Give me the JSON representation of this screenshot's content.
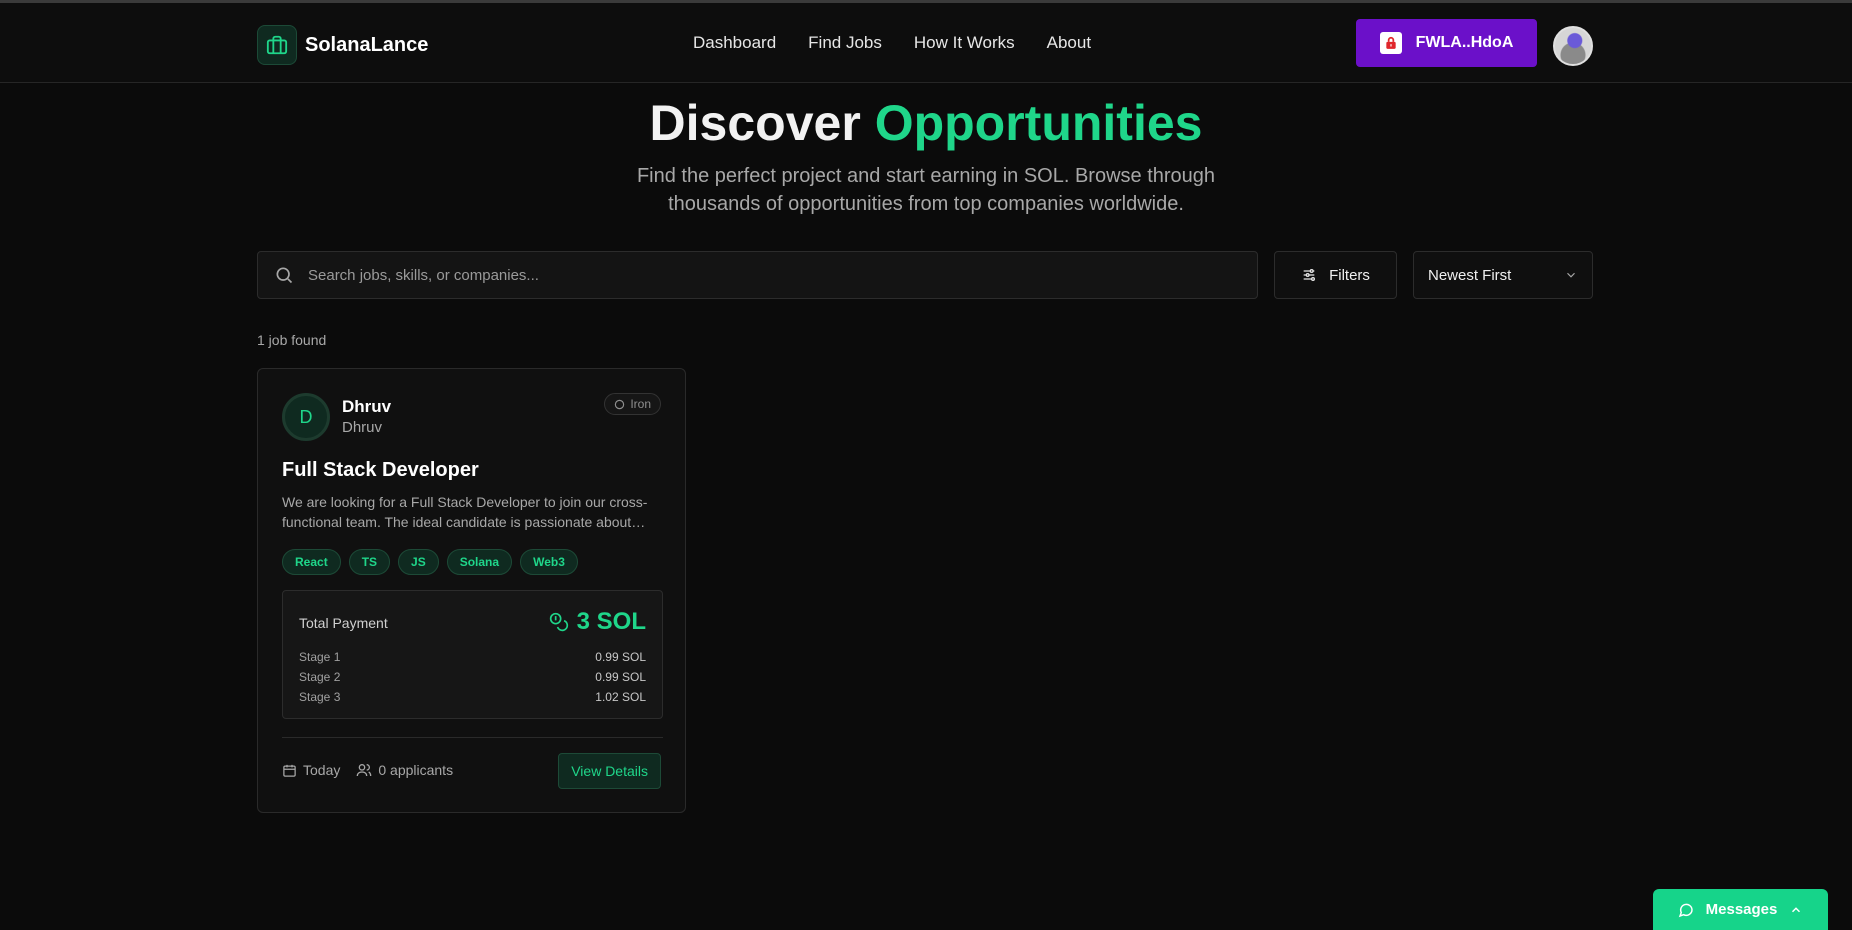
{
  "app": {
    "name": "SolanaLance"
  },
  "nav": {
    "links": [
      "Dashboard",
      "Find Jobs",
      "How It Works",
      "About"
    ]
  },
  "wallet": {
    "label": "FWLA..HdoA"
  },
  "hero": {
    "title_main": "Discover",
    "title_accent": "Opportunities",
    "subtitle": "Find the perfect project and start earning in SOL. Browse through thousands of opportunities from top companies worldwide."
  },
  "search": {
    "placeholder": "Search jobs, skills, or companies...",
    "value": ""
  },
  "filters": {
    "label": "Filters"
  },
  "sort": {
    "selected": "Newest First"
  },
  "results": {
    "count_text": "1 job found"
  },
  "jobs": [
    {
      "avatar_initial": "D",
      "poster_name": "Dhruv",
      "company": "Dhruv",
      "tier": "Iron",
      "title": "Full Stack Developer",
      "description": "We are looking for a Full Stack Developer to join our cross-functional team. The ideal candidate is passionate about building scalable products.",
      "tags": [
        "React",
        "TS",
        "JS",
        "Solana",
        "Web3"
      ],
      "payment": {
        "label": "Total Payment",
        "total": "3 SOL",
        "stages": [
          {
            "name": "Stage 1",
            "amount": "0.99 SOL"
          },
          {
            "name": "Stage 2",
            "amount": "0.99 SOL"
          },
          {
            "name": "Stage 3",
            "amount": "1.02 SOL"
          }
        ]
      },
      "posted": "Today",
      "applicants": "0 applicants",
      "cta": "View Details"
    }
  ],
  "messages": {
    "label": "Messages"
  },
  "colors": {
    "accent": "#1fd68a",
    "wallet": "#6b10c9",
    "background": "#0b0b0b"
  }
}
